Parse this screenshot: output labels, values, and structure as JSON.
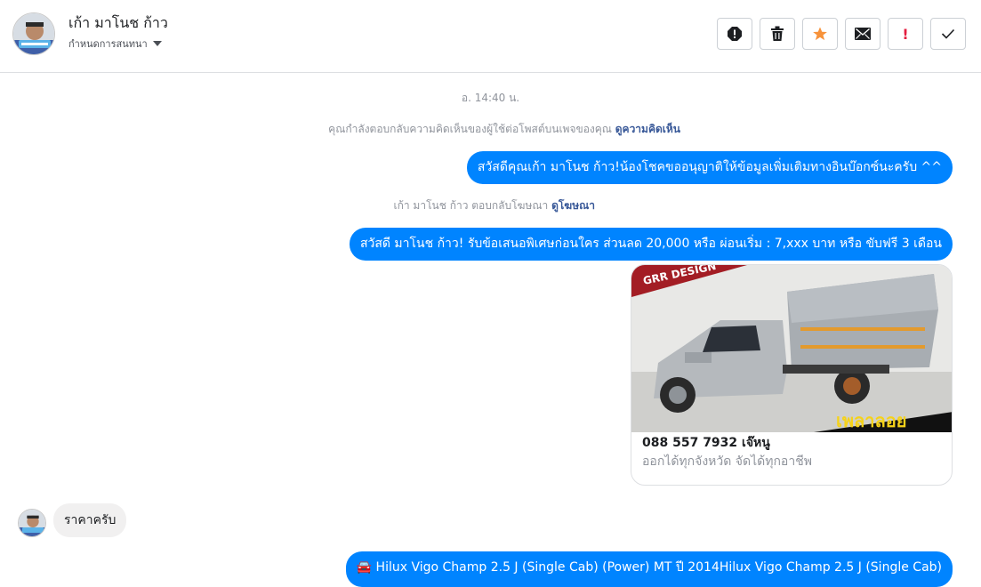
{
  "header": {
    "contact_name": "เก้า มาโนช ก้าว",
    "assign_label": "กำหนดการสนทนา",
    "actions": [
      {
        "name": "report-icon"
      },
      {
        "name": "trash-icon"
      },
      {
        "name": "star-icon",
        "color": "#f7923a"
      },
      {
        "name": "envelope-icon"
      },
      {
        "name": "exclamation-icon",
        "text": "!",
        "color": "#e41e3f"
      },
      {
        "name": "check-icon"
      }
    ]
  },
  "conversation": {
    "time": "อ. 14:40 น.",
    "system_1": {
      "text": "คุณกำลังตอบกลับความคิดเห็นของผู้ใช้ต่อโพสต์บนเพจของคุณ",
      "link": "ดูความคิดเห็น"
    },
    "message_1": "สวัสดีคุณเก้า มาโนช ก้าว!น้องโชคขออนุญาติให้ข้อมูลเพิ่มเติมทางอินบ๊อกซ์นะครับ ^^",
    "system_2": {
      "text": "เก้า มาโนช ก้าว ตอบกลับโฆษณา",
      "link": "ดูโฆษณา"
    },
    "message_2": "สวัสดี มาโนช ก้าว! รับข้อเสนอพิเศษก่อนใคร ส่วนลด 20,000 หรือ ผ่อนเริ่ม : 7,xxx บาท หรือ ขับฟรี 3 เดือน",
    "card": {
      "image_banner": "GRR DESIGN",
      "image_caption": "เพลาลอย",
      "title": "088 557 7932 เจ๊หนู",
      "subtitle": "ออกได้ทุกจังหวัด จัดได้ทุกอาชีพ"
    },
    "incoming_1": "ราคาครับ",
    "message_3": "🚘 Hilux Vigo Champ 2.5 J (Single Cab) (Power) MT ปี 2014Hilux Vigo Champ 2.5 J (Single Cab)"
  },
  "colors": {
    "brand_blue": "#0084ff",
    "link": "#385898",
    "muted": "#90949c"
  }
}
